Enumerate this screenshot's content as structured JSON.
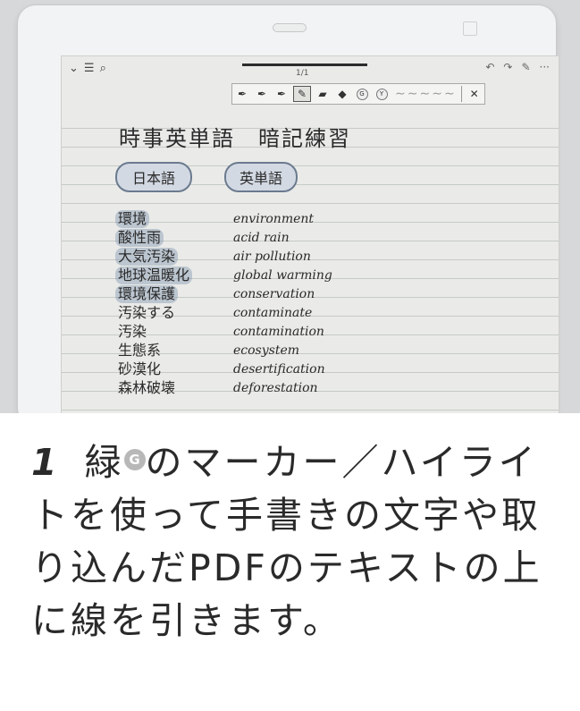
{
  "toolbar": {
    "dropdown_icon": "⌄",
    "menu_icon": "☰",
    "search_icon": "⌕",
    "page_indicator": "1/1",
    "undo_icon": "↶",
    "redo_icon": "↷",
    "pen_settings_icon": "✎",
    "more_icon": "···"
  },
  "tools": {
    "pen1": "✒",
    "pen2": "✒",
    "pen3": "✒",
    "pen4": "✎",
    "marker": "▰",
    "eraser": "◆",
    "green_label": "G",
    "yellow_label": "Y",
    "close_icon": "✕"
  },
  "note": {
    "title": "時事英単語　暗記練習",
    "header_ja": "日本語",
    "header_en": "英単語",
    "rows": [
      {
        "ja": "環境",
        "en": "environment"
      },
      {
        "ja": "酸性雨",
        "en": "acid rain"
      },
      {
        "ja": "大気汚染",
        "en": "air pollution"
      },
      {
        "ja": "地球温暖化",
        "en": "global warming"
      },
      {
        "ja": "環境保護",
        "en": "conservation"
      },
      {
        "ja": "汚染する",
        "en": "contaminate"
      },
      {
        "ja": "汚染",
        "en": "contamination"
      },
      {
        "ja": "生態系",
        "en": "ecosystem"
      },
      {
        "ja": "砂漠化",
        "en": "desertification"
      },
      {
        "ja": "森林破壊",
        "en": "deforestation"
      }
    ]
  },
  "caption": {
    "step": "1",
    "pre": "緑",
    "marker_label": "G",
    "post": "のマーカー／ハイライトを使って手書きの文字や取り込んだPDFのテキストの上に線を引きます。"
  },
  "colors": {
    "highlight": "#8498b4",
    "header_pill": "#d3d9e3",
    "screen": "#eaebe8"
  }
}
